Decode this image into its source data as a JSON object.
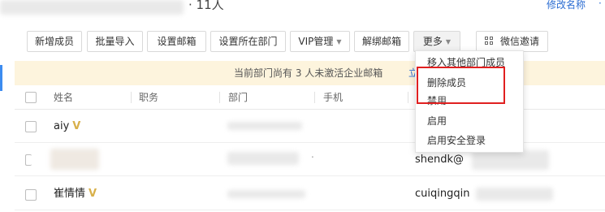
{
  "header": {
    "member_count": "· 11人",
    "rename_link": "修改名称",
    "rename_extra": "·"
  },
  "toolbar": {
    "add_member": "新增成员",
    "batch_import": "批量导入",
    "set_email": "设置邮箱",
    "set_department": "设置所在部门",
    "vip_manage": "VIP管理",
    "unbind_email": "解绑邮箱",
    "more": "更多",
    "wechat_invite": "微信邀请"
  },
  "notice": {
    "text": "当前部门尚有 3 人未激活企业邮箱",
    "link": "立即"
  },
  "table": {
    "columns": [
      "姓名",
      "职务",
      "部门",
      "手机"
    ],
    "rows": [
      {
        "name": "aiy",
        "vip": "V",
        "email": ""
      },
      {
        "name": "",
        "vip": "",
        "email": "shendk@"
      },
      {
        "name": "崔情情",
        "vip": "V",
        "email": "cuiqingqin"
      }
    ]
  },
  "dropdown": {
    "items": [
      "移入其他部门成员",
      "删除成员",
      "禁用",
      "启用",
      "启用安全登录"
    ]
  },
  "colors": {
    "link": "#2b6dd2",
    "notice_bg": "#fdf4dd",
    "vip_gold": "#d8b04a",
    "highlight_red": "#e02020",
    "accent_blue": "#3d8cf0"
  }
}
